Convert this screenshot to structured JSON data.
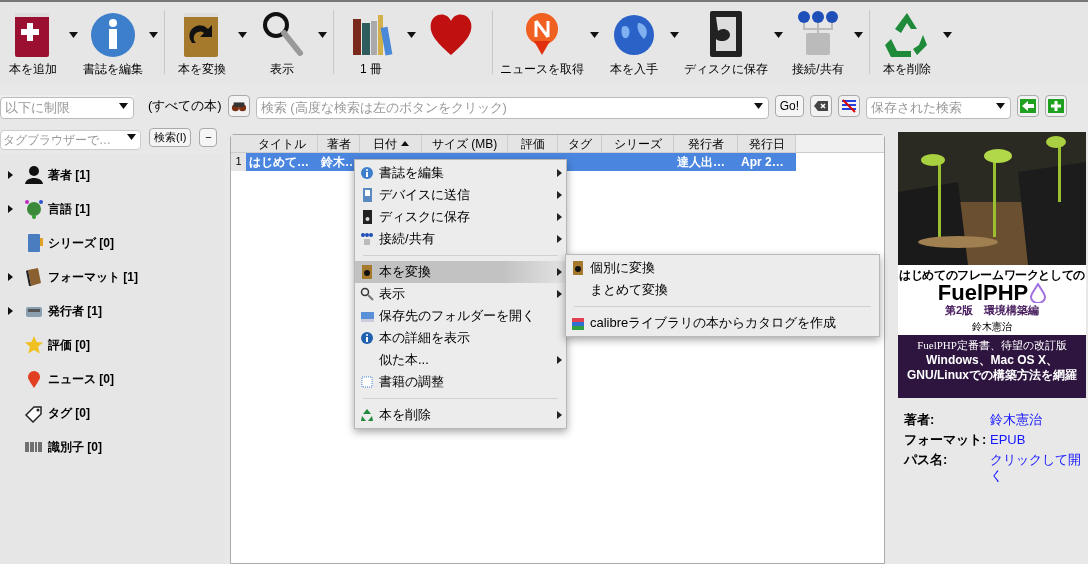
{
  "toolbar": {
    "groups": [
      [
        {
          "label": "本を追加",
          "dropdown": true
        },
        {
          "label": "書誌を編集",
          "dropdown": true
        }
      ],
      [
        {
          "label": "本を変換",
          "dropdown": true
        },
        {
          "label": "表示",
          "dropdown": true
        }
      ],
      [
        {
          "label": "1 冊",
          "dropdown": true
        },
        {
          "dropdown": false
        }
      ],
      [
        {
          "label": "ニュースを取得",
          "dropdown": true
        },
        {
          "label": "本を入手",
          "dropdown": true
        },
        {
          "label": "ディスクに保存",
          "dropdown": true
        },
        {
          "label": "接続/共有",
          "dropdown": true
        }
      ],
      [
        {
          "label": "本を削除",
          "dropdown": true
        }
      ]
    ]
  },
  "search_bar": {
    "restrict": {
      "placeholder": "以下に制限"
    },
    "scope": "(すべての本)",
    "search": {
      "placeholder": "検索 (高度な検索は左のボタンをクリック)"
    },
    "go": "Go!",
    "saved_search": {
      "placeholder": "保存された検索"
    }
  },
  "tag_browser": {
    "find": {
      "placeholder": "タグブラウザーで…"
    },
    "find_button": "検索(I)",
    "collapse_button": "−",
    "items": [
      {
        "label": "著者 [1]",
        "expandable": true
      },
      {
        "label": "言語 [1]",
        "expandable": true
      },
      {
        "label": "シリーズ [0]",
        "expandable": false
      },
      {
        "label": "フォーマット [1]",
        "expandable": true
      },
      {
        "label": "発行者 [1]",
        "expandable": true
      },
      {
        "label": "評価 [0]",
        "expandable": false
      },
      {
        "label": "ニュース [0]",
        "expandable": false
      },
      {
        "label": "タグ [0]",
        "expandable": false
      },
      {
        "label": "識別子 [0]",
        "expandable": false
      }
    ]
  },
  "table": {
    "columns": [
      {
        "label": "タイトル",
        "sorted": false
      },
      {
        "label": "著者",
        "sorted": false
      },
      {
        "label": "日付",
        "sorted": true
      },
      {
        "label": "サイズ (MB)",
        "sorted": false
      },
      {
        "label": "評価",
        "sorted": false
      },
      {
        "label": "タグ",
        "sorted": false
      },
      {
        "label": "シリーズ",
        "sorted": false
      },
      {
        "label": "発行者",
        "sorted": false
      },
      {
        "label": "発行日",
        "sorted": false
      }
    ],
    "rows": [
      {
        "number": "1",
        "selected": true,
        "cells": [
          "はじめて…",
          "鈴木…",
          null,
          null,
          null,
          null,
          null,
          "達人出…",
          "Apr 2…"
        ]
      }
    ]
  },
  "context_menu": {
    "items": [
      {
        "kind": "item",
        "label": "書誌を編集",
        "submenu": true,
        "selected": false
      },
      {
        "kind": "item",
        "label": "デバイスに送信",
        "submenu": true,
        "selected": false
      },
      {
        "kind": "item",
        "label": "ディスクに保存",
        "submenu": true,
        "selected": false
      },
      {
        "kind": "item",
        "label": "接続/共有",
        "submenu": true,
        "selected": false
      },
      {
        "kind": "separator"
      },
      {
        "kind": "item",
        "label": "本を変換",
        "submenu": true,
        "selected": true
      },
      {
        "kind": "item",
        "label": "表示",
        "submenu": true,
        "selected": false
      },
      {
        "kind": "item",
        "label": "保存先のフォルダーを開く",
        "submenu": false,
        "selected": false
      },
      {
        "kind": "item",
        "label": "本の詳細を表示",
        "submenu": false,
        "selected": false
      },
      {
        "kind": "item",
        "label": "似た本...",
        "submenu": true,
        "selected": false
      },
      {
        "kind": "item",
        "label": "書籍の調整",
        "submenu": false,
        "selected": false
      },
      {
        "kind": "separator"
      },
      {
        "kind": "item",
        "label": "本を削除",
        "submenu": true,
        "selected": false
      }
    ]
  },
  "submenu": {
    "items": [
      {
        "kind": "item",
        "label": "個別に変換"
      },
      {
        "kind": "item",
        "label": "まとめて変換"
      },
      {
        "kind": "separator"
      },
      {
        "kind": "item",
        "label": "calibreライブラリの本からカタログを作成"
      }
    ]
  },
  "book_details": {
    "cover": {
      "subtitle": "はじめてのフレームワークとしての",
      "title": "FuelPHP",
      "edition": "第2版　環境構築編",
      "author": "鈴木憲治",
      "tagline": "FuelPHP定番書、待望の改訂版",
      "headline": "Windows、Mac OS X、GNU/Linuxでの構築方法を網羅"
    },
    "fields": [
      {
        "label": "著者:",
        "value": "鈴木憲治"
      },
      {
        "label": "フォーマット:",
        "value": "EPUB"
      },
      {
        "label": "パス名:",
        "value": "クリックして開く"
      }
    ]
  }
}
